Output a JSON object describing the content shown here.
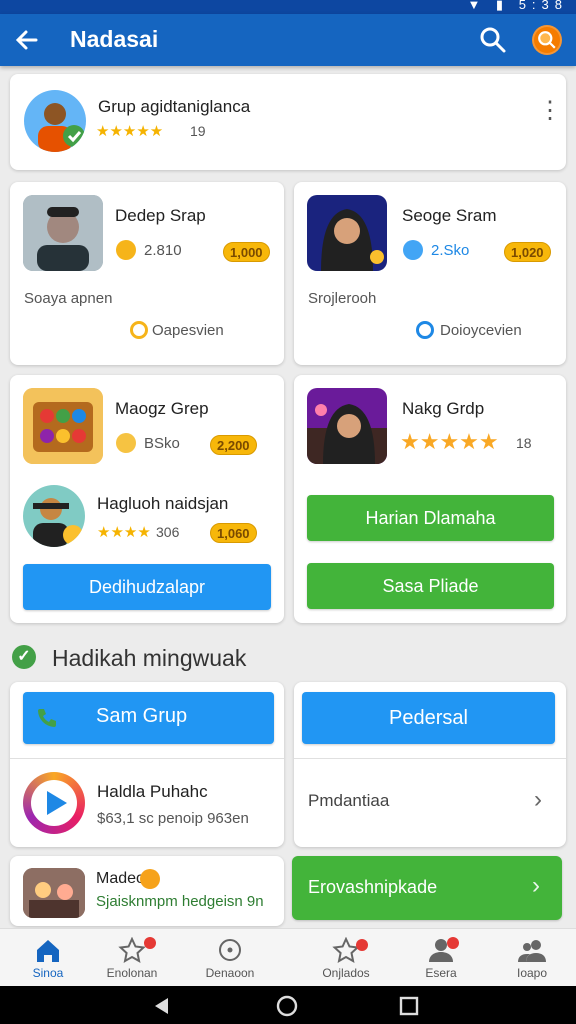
{
  "status": {
    "time": "5:38"
  },
  "appbar": {
    "title": "Nadasai"
  },
  "profile": {
    "name": "Grup agidtaniglanca",
    "stars": "★★★★★",
    "rating": "19"
  },
  "cards": [
    {
      "title": "Dedep Srap",
      "stat": "2.810",
      "coins": "1,000",
      "sub": "Soaya apnen",
      "link": "Oapesvien"
    },
    {
      "title": "Seoge Sram",
      "stat": "2.Sko",
      "coins": "1,020",
      "sub": "Srojlerooh",
      "link": "Doioycevien"
    },
    {
      "title": "Maogz Grep",
      "stat": "BSko",
      "coins": "2,200"
    },
    {
      "title": "Nakg Grdp",
      "stars": "★★★★★",
      "rating": "18"
    },
    {
      "title": "Hagluoh naidsjan",
      "stars": "★★★★",
      "rating": "306",
      "coins": "1,060"
    }
  ],
  "buttons": {
    "dedih": "Dedihudzalapr",
    "harian": "Harian Dlamaha",
    "sasa": "Sasa Pliade",
    "samgrup": "Sam Grup",
    "pedersal": "Pedersal",
    "erovash": "Erovashnipkade"
  },
  "section": {
    "title": "Hadikah mingwuak"
  },
  "list": [
    {
      "title": "Haldla Puhahc",
      "sub": "$63,1 sc penoip 963en"
    },
    {
      "title": "Pmdantiaa"
    },
    {
      "title": "Madeo",
      "sub": "Sjaisknmpm hedgeisn 9n"
    }
  ],
  "nav": [
    {
      "label": "Sinoa"
    },
    {
      "label": "Enolonan"
    },
    {
      "label": "Denaoon"
    },
    {
      "label": "Onjlados"
    },
    {
      "label": "Esera"
    },
    {
      "label": "Ioapo"
    }
  ]
}
